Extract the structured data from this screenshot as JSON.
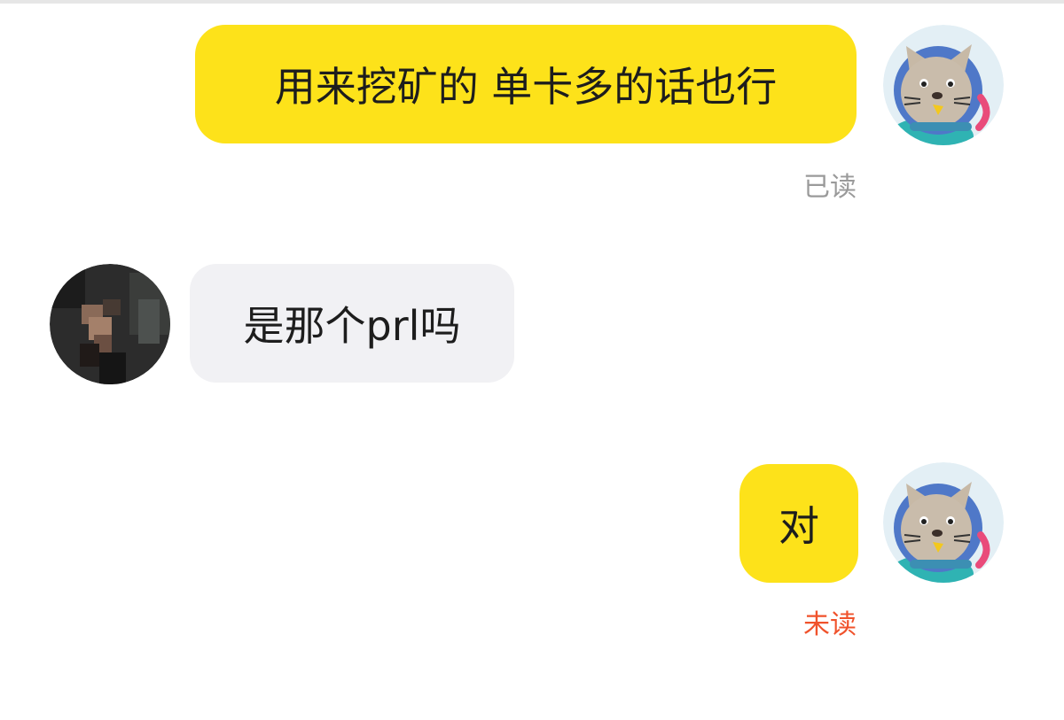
{
  "colors": {
    "outgoing_bubble": "#fde21a",
    "incoming_bubble": "#f1f1f4",
    "read_status": "#9a9a9a",
    "unread_status": "#f0522b"
  },
  "messages": [
    {
      "direction": "outgoing",
      "text": "用来挖矿的 单卡多的话也行",
      "status": "已读",
      "avatar_icon": "cat-astronaut-avatar-icon"
    },
    {
      "direction": "incoming",
      "text": "是那个prl吗",
      "avatar_icon": "pixelated-user-avatar-icon"
    },
    {
      "direction": "outgoing",
      "text": "对",
      "status": "未读",
      "avatar_icon": "cat-astronaut-avatar-icon"
    }
  ]
}
